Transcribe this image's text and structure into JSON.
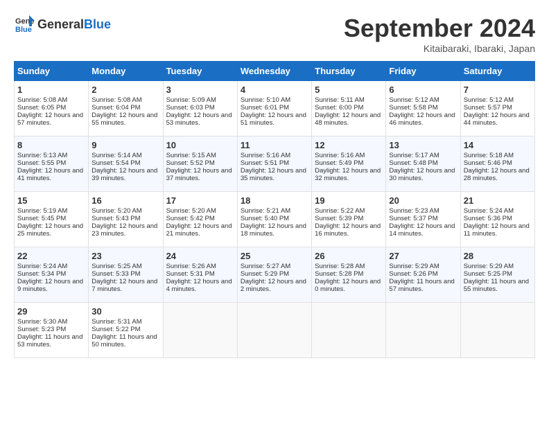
{
  "header": {
    "logo_general": "General",
    "logo_blue": "Blue",
    "title": "September 2024",
    "location": "Kitaibaraki, Ibaraki, Japan"
  },
  "days_of_week": [
    "Sunday",
    "Monday",
    "Tuesday",
    "Wednesday",
    "Thursday",
    "Friday",
    "Saturday"
  ],
  "weeks": [
    [
      {
        "day": "1",
        "sunrise": "Sunrise: 5:08 AM",
        "sunset": "Sunset: 6:05 PM",
        "daylight": "Daylight: 12 hours and 57 minutes."
      },
      {
        "day": "2",
        "sunrise": "Sunrise: 5:08 AM",
        "sunset": "Sunset: 6:04 PM",
        "daylight": "Daylight: 12 hours and 55 minutes."
      },
      {
        "day": "3",
        "sunrise": "Sunrise: 5:09 AM",
        "sunset": "Sunset: 6:03 PM",
        "daylight": "Daylight: 12 hours and 53 minutes."
      },
      {
        "day": "4",
        "sunrise": "Sunrise: 5:10 AM",
        "sunset": "Sunset: 6:01 PM",
        "daylight": "Daylight: 12 hours and 51 minutes."
      },
      {
        "day": "5",
        "sunrise": "Sunrise: 5:11 AM",
        "sunset": "Sunset: 6:00 PM",
        "daylight": "Daylight: 12 hours and 48 minutes."
      },
      {
        "day": "6",
        "sunrise": "Sunrise: 5:12 AM",
        "sunset": "Sunset: 5:58 PM",
        "daylight": "Daylight: 12 hours and 46 minutes."
      },
      {
        "day": "7",
        "sunrise": "Sunrise: 5:12 AM",
        "sunset": "Sunset: 5:57 PM",
        "daylight": "Daylight: 12 hours and 44 minutes."
      }
    ],
    [
      {
        "day": "8",
        "sunrise": "Sunrise: 5:13 AM",
        "sunset": "Sunset: 5:55 PM",
        "daylight": "Daylight: 12 hours and 41 minutes."
      },
      {
        "day": "9",
        "sunrise": "Sunrise: 5:14 AM",
        "sunset": "Sunset: 5:54 PM",
        "daylight": "Daylight: 12 hours and 39 minutes."
      },
      {
        "day": "10",
        "sunrise": "Sunrise: 5:15 AM",
        "sunset": "Sunset: 5:52 PM",
        "daylight": "Daylight: 12 hours and 37 minutes."
      },
      {
        "day": "11",
        "sunrise": "Sunrise: 5:16 AM",
        "sunset": "Sunset: 5:51 PM",
        "daylight": "Daylight: 12 hours and 35 minutes."
      },
      {
        "day": "12",
        "sunrise": "Sunrise: 5:16 AM",
        "sunset": "Sunset: 5:49 PM",
        "daylight": "Daylight: 12 hours and 32 minutes."
      },
      {
        "day": "13",
        "sunrise": "Sunrise: 5:17 AM",
        "sunset": "Sunset: 5:48 PM",
        "daylight": "Daylight: 12 hours and 30 minutes."
      },
      {
        "day": "14",
        "sunrise": "Sunrise: 5:18 AM",
        "sunset": "Sunset: 5:46 PM",
        "daylight": "Daylight: 12 hours and 28 minutes."
      }
    ],
    [
      {
        "day": "15",
        "sunrise": "Sunrise: 5:19 AM",
        "sunset": "Sunset: 5:45 PM",
        "daylight": "Daylight: 12 hours and 25 minutes."
      },
      {
        "day": "16",
        "sunrise": "Sunrise: 5:20 AM",
        "sunset": "Sunset: 5:43 PM",
        "daylight": "Daylight: 12 hours and 23 minutes."
      },
      {
        "day": "17",
        "sunrise": "Sunrise: 5:20 AM",
        "sunset": "Sunset: 5:42 PM",
        "daylight": "Daylight: 12 hours and 21 minutes."
      },
      {
        "day": "18",
        "sunrise": "Sunrise: 5:21 AM",
        "sunset": "Sunset: 5:40 PM",
        "daylight": "Daylight: 12 hours and 18 minutes."
      },
      {
        "day": "19",
        "sunrise": "Sunrise: 5:22 AM",
        "sunset": "Sunset: 5:39 PM",
        "daylight": "Daylight: 12 hours and 16 minutes."
      },
      {
        "day": "20",
        "sunrise": "Sunrise: 5:23 AM",
        "sunset": "Sunset: 5:37 PM",
        "daylight": "Daylight: 12 hours and 14 minutes."
      },
      {
        "day": "21",
        "sunrise": "Sunrise: 5:24 AM",
        "sunset": "Sunset: 5:36 PM",
        "daylight": "Daylight: 12 hours and 11 minutes."
      }
    ],
    [
      {
        "day": "22",
        "sunrise": "Sunrise: 5:24 AM",
        "sunset": "Sunset: 5:34 PM",
        "daylight": "Daylight: 12 hours and 9 minutes."
      },
      {
        "day": "23",
        "sunrise": "Sunrise: 5:25 AM",
        "sunset": "Sunset: 5:33 PM",
        "daylight": "Daylight: 12 hours and 7 minutes."
      },
      {
        "day": "24",
        "sunrise": "Sunrise: 5:26 AM",
        "sunset": "Sunset: 5:31 PM",
        "daylight": "Daylight: 12 hours and 4 minutes."
      },
      {
        "day": "25",
        "sunrise": "Sunrise: 5:27 AM",
        "sunset": "Sunset: 5:29 PM",
        "daylight": "Daylight: 12 hours and 2 minutes."
      },
      {
        "day": "26",
        "sunrise": "Sunrise: 5:28 AM",
        "sunset": "Sunset: 5:28 PM",
        "daylight": "Daylight: 12 hours and 0 minutes."
      },
      {
        "day": "27",
        "sunrise": "Sunrise: 5:29 AM",
        "sunset": "Sunset: 5:26 PM",
        "daylight": "Daylight: 11 hours and 57 minutes."
      },
      {
        "day": "28",
        "sunrise": "Sunrise: 5:29 AM",
        "sunset": "Sunset: 5:25 PM",
        "daylight": "Daylight: 11 hours and 55 minutes."
      }
    ],
    [
      {
        "day": "29",
        "sunrise": "Sunrise: 5:30 AM",
        "sunset": "Sunset: 5:23 PM",
        "daylight": "Daylight: 11 hours and 53 minutes."
      },
      {
        "day": "30",
        "sunrise": "Sunrise: 5:31 AM",
        "sunset": "Sunset: 5:22 PM",
        "daylight": "Daylight: 11 hours and 50 minutes."
      },
      null,
      null,
      null,
      null,
      null
    ]
  ]
}
